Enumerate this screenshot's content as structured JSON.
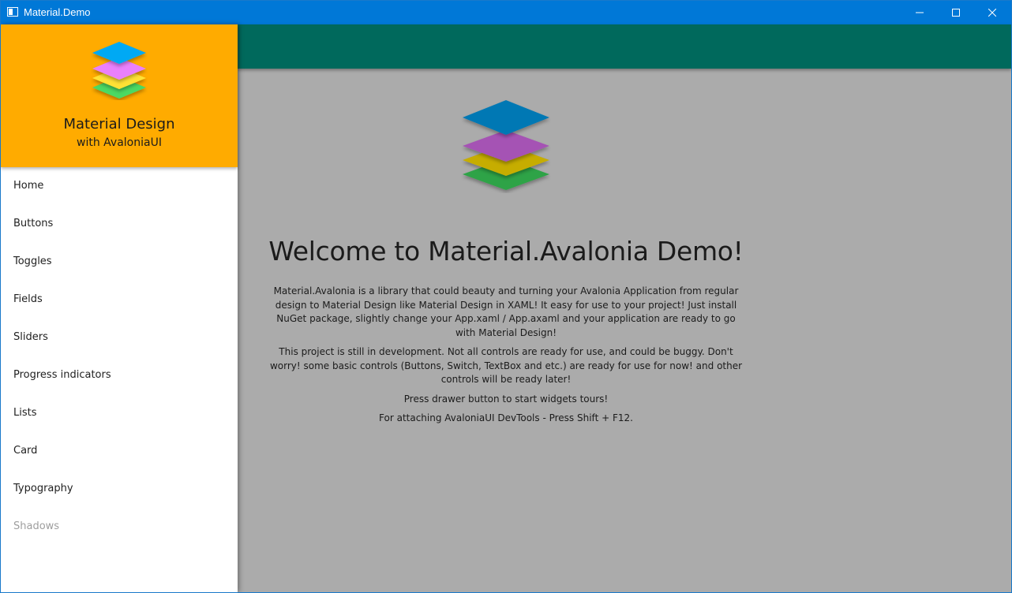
{
  "window": {
    "title": "Material.Demo",
    "controls": [
      "minimize-icon",
      "maximize-icon",
      "close-icon"
    ]
  },
  "drawer": {
    "title": "Material Design",
    "subtitle": "with AvaloniaUI",
    "header_color": "#ffab00",
    "items": [
      {
        "label": "Home"
      },
      {
        "label": "Buttons"
      },
      {
        "label": "Toggles"
      },
      {
        "label": "Fields"
      },
      {
        "label": "Sliders"
      },
      {
        "label": "Progress indicators"
      },
      {
        "label": "Lists"
      },
      {
        "label": "Card"
      },
      {
        "label": "Typography"
      },
      {
        "label": "Shadows"
      }
    ]
  },
  "main": {
    "appbar_color": "#00695c",
    "welcome_title": "Welcome to Material.Avalonia Demo!",
    "paragraphs": [
      "Material.Avalonia is a library that could beauty and turning your Avalonia Application from regular design to Material Design like Material Design in XAML! It easy for use to your project! Just install NuGet package, slightly change your App.xaml / App.axaml and your application are ready to go with Material Design!",
      "This project is still in development. Not all controls are ready for use, and could be buggy. Don't worry! some basic controls (Buttons, Switch, TextBox and etc.) are ready for use for now! and other controls will be ready later!",
      "Press drawer button to start widgets tours!",
      "For attaching AvaloniaUI DevTools - Press Shift + F12."
    ]
  },
  "colors": {
    "titlebar": "#0078d7",
    "overlay_background": "#ababab",
    "logo_layers": [
      "#03a9f4",
      "#ea80fc",
      "#ffeb3b",
      "#69f0ae"
    ]
  }
}
